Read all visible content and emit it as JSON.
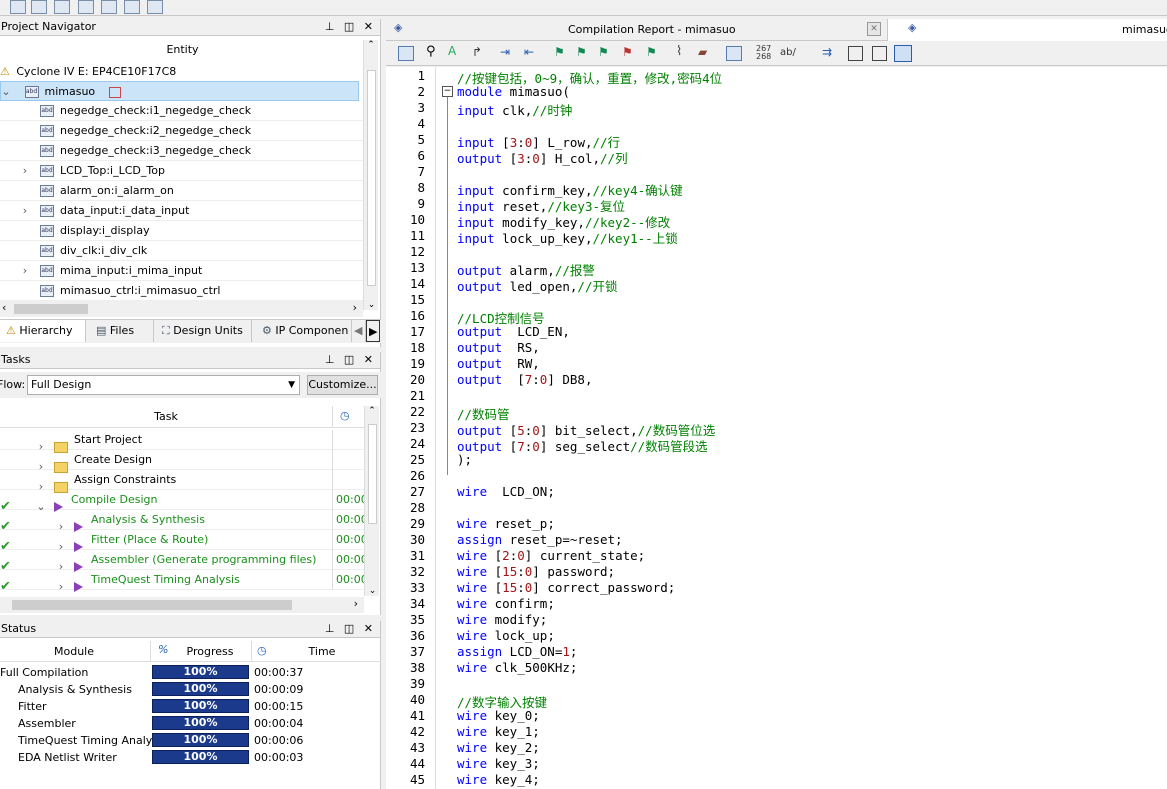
{
  "project_navigator": {
    "title": "Project Navigator",
    "column": "Entity",
    "device": "Cyclone IV E: EP4CE10F17C8",
    "root": "mimasuo",
    "items": [
      {
        "label": "negedge_check:i1_negedge_check",
        "expandable": false
      },
      {
        "label": "negedge_check:i2_negedge_check",
        "expandable": false
      },
      {
        "label": "negedge_check:i3_negedge_check",
        "expandable": false
      },
      {
        "label": "LCD_Top:i_LCD_Top",
        "expandable": true
      },
      {
        "label": "alarm_on:i_alarm_on",
        "expandable": false
      },
      {
        "label": "data_input:i_data_input",
        "expandable": true
      },
      {
        "label": "display:i_display",
        "expandable": false
      },
      {
        "label": "div_clk:i_div_clk",
        "expandable": false
      },
      {
        "label": "mima_input:i_mima_input",
        "expandable": true
      },
      {
        "label": "mimasuo_ctrl:i_mimasuo_ctrl",
        "expandable": false
      }
    ],
    "tabs": [
      "Hierarchy",
      "Files",
      "Design Units",
      "IP Componen"
    ]
  },
  "tasks": {
    "title": "Tasks",
    "flow_label": "Flow:",
    "flow_value": "Full Design",
    "customize": "Customize...",
    "column_task": "Task",
    "items": [
      {
        "label": "Start Project",
        "time": "",
        "done": false,
        "kind": "folder",
        "indent": 0
      },
      {
        "label": "Create Design",
        "time": "",
        "done": false,
        "kind": "folder",
        "indent": 0
      },
      {
        "label": "Assign Constraints",
        "time": "",
        "done": false,
        "kind": "folder",
        "indent": 0
      },
      {
        "label": "Compile Design",
        "time": "00:00",
        "done": true,
        "kind": "play",
        "indent": 0
      },
      {
        "label": "Analysis & Synthesis",
        "time": "00:00",
        "done": true,
        "kind": "play",
        "indent": 1
      },
      {
        "label": "Fitter (Place & Route)",
        "time": "00:00",
        "done": true,
        "kind": "play",
        "indent": 1
      },
      {
        "label": "Assembler (Generate programming files)",
        "time": "00:00",
        "done": true,
        "kind": "play",
        "indent": 1
      },
      {
        "label": "TimeQuest Timing Analysis",
        "time": "00:00",
        "done": true,
        "kind": "play",
        "indent": 1
      }
    ]
  },
  "status": {
    "title": "Status",
    "col_module": "Module",
    "col_progress": "Progress",
    "col_time": "Time",
    "rows": [
      {
        "module": "Full Compilation",
        "progress": "100%",
        "time": "00:00:37",
        "indent": 0
      },
      {
        "module": "Analysis & Synthesis",
        "progress": "100%",
        "time": "00:00:09",
        "indent": 1
      },
      {
        "module": "Fitter",
        "progress": "100%",
        "time": "00:00:15",
        "indent": 1
      },
      {
        "module": "Assembler",
        "progress": "100%",
        "time": "00:00:04",
        "indent": 1
      },
      {
        "module": "TimeQuest Timing Analyzer",
        "progress": "100%",
        "time": "00:00:06",
        "indent": 1
      },
      {
        "module": "EDA Netlist Writer",
        "progress": "100%",
        "time": "00:00:03",
        "indent": 1
      }
    ]
  },
  "editor": {
    "tab_report": "Compilation Report - mimasuo",
    "tab_file": "mimasuo.",
    "toolbar_numbers": "267\n268",
    "toolbar_ab": "ab/",
    "lines": [
      [
        [
          "cm",
          "//按键包括，0~9，确认，重置，修改,密码4位"
        ]
      ],
      [
        [
          "kw",
          "module"
        ],
        [
          "txt",
          " mimasuo("
        ]
      ],
      [
        [
          "kw",
          "input"
        ],
        [
          "txt",
          " clk,"
        ],
        [
          "cm",
          "//时钟"
        ]
      ],
      [],
      [
        [
          "kw",
          "input"
        ],
        [
          "txt",
          " ["
        ],
        [
          "num",
          "3"
        ],
        [
          "txt",
          ":"
        ],
        [
          "num",
          "0"
        ],
        [
          "txt",
          "] L_row,"
        ],
        [
          "cm",
          "//行"
        ]
      ],
      [
        [
          "kw",
          "output"
        ],
        [
          "txt",
          " ["
        ],
        [
          "num",
          "3"
        ],
        [
          "txt",
          ":"
        ],
        [
          "num",
          "0"
        ],
        [
          "txt",
          "] H_col,"
        ],
        [
          "cm",
          "//列"
        ]
      ],
      [],
      [
        [
          "kw",
          "input"
        ],
        [
          "txt",
          " confirm_key,"
        ],
        [
          "cm",
          "//key4-确认键"
        ]
      ],
      [
        [
          "kw",
          "input"
        ],
        [
          "txt",
          " reset,"
        ],
        [
          "cm",
          "//key3-复位"
        ]
      ],
      [
        [
          "kw",
          "input"
        ],
        [
          "txt",
          " modify_key,"
        ],
        [
          "cm",
          "//key2--修改"
        ]
      ],
      [
        [
          "kw",
          "input"
        ],
        [
          "txt",
          " lock_up_key,"
        ],
        [
          "cm",
          "//key1--上锁"
        ]
      ],
      [],
      [
        [
          "kw",
          "output"
        ],
        [
          "txt",
          " alarm,"
        ],
        [
          "cm",
          "//报警"
        ]
      ],
      [
        [
          "kw",
          "output"
        ],
        [
          "txt",
          " led_open,"
        ],
        [
          "cm",
          "//开锁"
        ]
      ],
      [],
      [
        [
          "cm",
          "//LCD控制信号"
        ]
      ],
      [
        [
          "kw",
          "output"
        ],
        [
          "txt",
          "  LCD_EN,"
        ]
      ],
      [
        [
          "kw",
          "output"
        ],
        [
          "txt",
          "  RS,"
        ]
      ],
      [
        [
          "kw",
          "output"
        ],
        [
          "txt",
          "  RW,"
        ]
      ],
      [
        [
          "kw",
          "output"
        ],
        [
          "txt",
          "  ["
        ],
        [
          "num",
          "7"
        ],
        [
          "txt",
          ":"
        ],
        [
          "num",
          "0"
        ],
        [
          "txt",
          "] DB8,"
        ]
      ],
      [],
      [
        [
          "cm",
          "//数码管"
        ]
      ],
      [
        [
          "kw",
          "output"
        ],
        [
          "txt",
          " ["
        ],
        [
          "num",
          "5"
        ],
        [
          "txt",
          ":"
        ],
        [
          "num",
          "0"
        ],
        [
          "txt",
          "] bit_select,"
        ],
        [
          "cm",
          "//数码管位选"
        ]
      ],
      [
        [
          "kw",
          "output"
        ],
        [
          "txt",
          " ["
        ],
        [
          "num",
          "7"
        ],
        [
          "txt",
          ":"
        ],
        [
          "num",
          "0"
        ],
        [
          "txt",
          "] seg_select"
        ],
        [
          "cm",
          "//数码管段选"
        ]
      ],
      [
        [
          "txt",
          ");"
        ]
      ],
      [],
      [
        [
          "kw",
          "wire"
        ],
        [
          "txt",
          "  LCD_ON;"
        ]
      ],
      [],
      [
        [
          "kw",
          "wire"
        ],
        [
          "txt",
          " reset_p;"
        ]
      ],
      [
        [
          "kw",
          "assign"
        ],
        [
          "txt",
          " reset_p=~reset;"
        ]
      ],
      [
        [
          "kw",
          "wire"
        ],
        [
          "txt",
          " ["
        ],
        [
          "num",
          "2"
        ],
        [
          "txt",
          ":"
        ],
        [
          "num",
          "0"
        ],
        [
          "txt",
          "] current_state;"
        ]
      ],
      [
        [
          "kw",
          "wire"
        ],
        [
          "txt",
          " ["
        ],
        [
          "num",
          "15"
        ],
        [
          "txt",
          ":"
        ],
        [
          "num",
          "0"
        ],
        [
          "txt",
          "] password;"
        ]
      ],
      [
        [
          "kw",
          "wire"
        ],
        [
          "txt",
          " ["
        ],
        [
          "num",
          "15"
        ],
        [
          "txt",
          ":"
        ],
        [
          "num",
          "0"
        ],
        [
          "txt",
          "] correct_password;"
        ]
      ],
      [
        [
          "kw",
          "wire"
        ],
        [
          "txt",
          " confirm;"
        ]
      ],
      [
        [
          "kw",
          "wire"
        ],
        [
          "txt",
          " modify;"
        ]
      ],
      [
        [
          "kw",
          "wire"
        ],
        [
          "txt",
          " lock_up;"
        ]
      ],
      [
        [
          "kw",
          "assign"
        ],
        [
          "txt",
          " LCD_ON="
        ],
        [
          "num",
          "1"
        ],
        [
          "txt",
          ";"
        ]
      ],
      [
        [
          "kw",
          "wire"
        ],
        [
          "txt",
          " clk_500KHz;"
        ]
      ],
      [],
      [
        [
          "cm",
          "//数字输入按键"
        ]
      ],
      [
        [
          "kw",
          "wire"
        ],
        [
          "txt",
          " key_0;"
        ]
      ],
      [
        [
          "kw",
          "wire"
        ],
        [
          "txt",
          " key_1;"
        ]
      ],
      [
        [
          "kw",
          "wire"
        ],
        [
          "txt",
          " key_2;"
        ]
      ],
      [
        [
          "kw",
          "wire"
        ],
        [
          "txt",
          " key_3;"
        ]
      ],
      [
        [
          "kw",
          "wire"
        ],
        [
          "txt",
          " key_4;"
        ]
      ]
    ]
  },
  "colors": {
    "keyword": "#0000ff",
    "comment": "#008000",
    "number": "#a31515",
    "progress": "#1b3a8c",
    "done": "#1a8f1a"
  },
  "icons": [
    "check-icon",
    "play-icon",
    "folder-icon",
    "abd-icon",
    "clock-icon",
    "pin-icon",
    "close-icon"
  ]
}
